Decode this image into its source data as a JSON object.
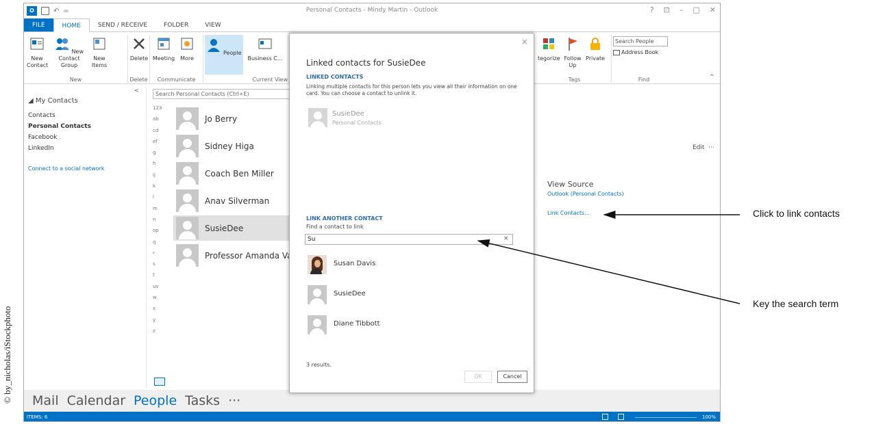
{
  "credit": "© by_nicholas/iStockphoto",
  "window": {
    "title": "Personal Contacts - Mindy Martin - Outlook",
    "controls": [
      "?",
      "⊡",
      "–",
      "□",
      "✕"
    ]
  },
  "qat": {
    "app_badge": "O",
    "undo": "↶",
    "more": "="
  },
  "tabs": [
    "FILE",
    "HOME",
    "SEND / RECEIVE",
    "FOLDER",
    "VIEW"
  ],
  "ribbon": {
    "new_contact": "New Contact",
    "new_contact_group": "New Contact Group",
    "new_items": "New Items",
    "new_group": "New",
    "delete": "Delete",
    "delete_group": "Delete",
    "meeting": "Meeting",
    "more": "More",
    "communicate_group": "Communicate",
    "people": "People",
    "business": "Business C...",
    "current_view_group": "Current View",
    "categorize": "tegorize",
    "follow_up": "Follow Up",
    "private": "Private",
    "tags_group": "Tags",
    "search_people": "Search People",
    "address_book": "Address Book",
    "find_group": "Find",
    "collapse": "^"
  },
  "nav": {
    "collapse": "<",
    "header": "◢ My Contacts",
    "items": [
      "Contacts",
      "Personal Contacts",
      "Facebook",
      "LinkedIn"
    ],
    "social": "Connect to a social network"
  },
  "list": {
    "search_placeholder": "Search Personal Contacts (Ctrl+E)",
    "alpha": [
      "123",
      "ab",
      "cd",
      "ef",
      "g",
      "h",
      "ij",
      "k",
      "l",
      "m",
      "n",
      "op",
      "q",
      "r",
      "s",
      "t",
      "uv",
      "w",
      "x",
      "y",
      "z"
    ],
    "contacts": [
      "Jo Berry",
      "Sidney Higa",
      "Coach Ben Miller",
      "Anav Silverman",
      "SusieDee",
      "Professor Amanda Va"
    ]
  },
  "detail": {
    "edit": "Edit",
    "more": "···",
    "view_source": "View Source",
    "source": "Outlook (Personal Contacts)",
    "link_contacts": "Link Contacts..."
  },
  "dialog": {
    "close": "×",
    "title": "Linked contacts for SusieDee",
    "linked_header": "LINKED CONTACTS",
    "description": "Linking multiple contacts for this person lets you view all their information on one card. You can choose a contact to unlink it.",
    "linked": {
      "name": "SusieDee",
      "source": "Personal Contacts"
    },
    "link_another_header": "LINK ANOTHER CONTACT",
    "find_label": "Find a contact to link",
    "search_value": "Su",
    "clear": "×",
    "results": [
      "Susan Davis",
      "SusieDee",
      "Diane Tibbott"
    ],
    "count": "3 results.",
    "ok": "OK",
    "cancel": "Cancel"
  },
  "bottomnav": {
    "mail": "Mail",
    "calendar": "Calendar",
    "people": "People",
    "tasks": "Tasks",
    "more": "···"
  },
  "status": {
    "items": "ITEMS: 6",
    "zoom": "100%"
  },
  "callouts": {
    "link": "Click to link contacts",
    "search": "Key the search term"
  }
}
